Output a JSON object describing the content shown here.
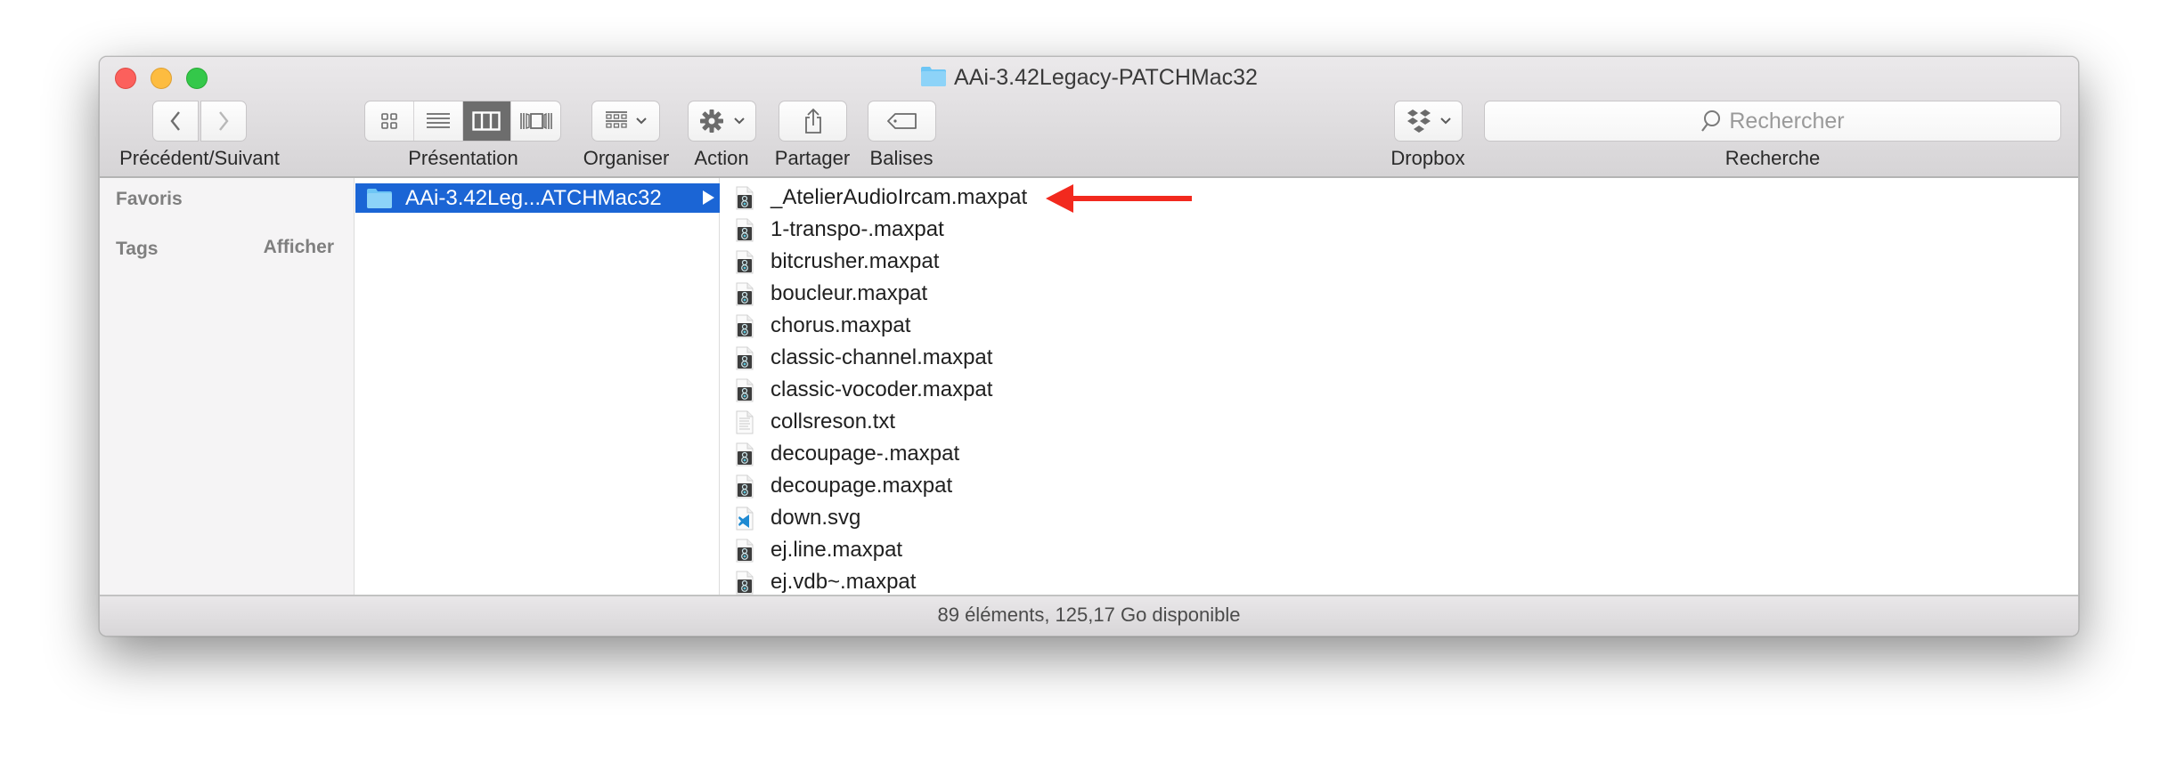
{
  "window": {
    "title": "AAi-3.42Legacy-PATCHMac32",
    "traffic_lights": [
      "close",
      "minimize",
      "zoom"
    ]
  },
  "toolbar": {
    "nav_label": "Précédent/Suivant",
    "view_label": "Présentation",
    "view_modes": [
      "icon-view",
      "list-view",
      "column-view",
      "cover-flow-view"
    ],
    "active_view": "column-view",
    "arrange_label": "Organiser",
    "action_label": "Action",
    "share_label": "Partager",
    "tags_label": "Balises",
    "dropbox_label": "Dropbox",
    "search_label": "Recherche",
    "search_placeholder": "Rechercher"
  },
  "sidebar": {
    "favorites_label": "Favoris",
    "tags_label": "Tags",
    "show_label": "Afficher"
  },
  "columns": {
    "column1": {
      "selected_folder": "AAi-3.42Leg...ATCHMac32"
    },
    "column2": {
      "files": [
        {
          "name": "_AtelierAudioIrcam.maxpat",
          "icon": "maxpat-icon",
          "tag": null
        },
        {
          "name": "1-transpo-.maxpat",
          "icon": "maxpat-icon",
          "tag": "#4fb7f7"
        },
        {
          "name": "bitcrusher.maxpat",
          "icon": "maxpat-icon",
          "tag": "#d389e4"
        },
        {
          "name": "boucleur.maxpat",
          "icon": "maxpat-icon",
          "tag": "#d389e4"
        },
        {
          "name": "chorus.maxpat",
          "icon": "maxpat-icon",
          "tag": "#d389e4"
        },
        {
          "name": "classic-channel.maxpat",
          "icon": "maxpat-icon",
          "tag": null
        },
        {
          "name": "classic-vocoder.maxpat",
          "icon": "maxpat-icon",
          "tag": null
        },
        {
          "name": "collsreson.txt",
          "icon": "text-file-icon",
          "tag": null
        },
        {
          "name": "decoupage-.maxpat",
          "icon": "maxpat-icon",
          "tag": "#4fb7f7"
        },
        {
          "name": "decoupage.maxpat",
          "icon": "maxpat-icon",
          "tag": "#d389e4"
        },
        {
          "name": "down.svg",
          "icon": "svg-file-icon",
          "tag": null
        },
        {
          "name": "ej.line.maxpat",
          "icon": "maxpat-icon",
          "tag": "#a0a0a0"
        },
        {
          "name": "ej.vdb~.maxpat",
          "icon": "maxpat-icon",
          "tag": "#a0a0a0"
        }
      ]
    }
  },
  "annotation": {
    "type": "red-arrow",
    "points_to": "_AtelierAudioIrcam.maxpat",
    "color": "#f2291e"
  },
  "statusbar": {
    "text": "89 éléments, 125,17 Go disponible"
  },
  "colors": {
    "selection": "#1b65d5",
    "folder": "#6ec6f5"
  }
}
